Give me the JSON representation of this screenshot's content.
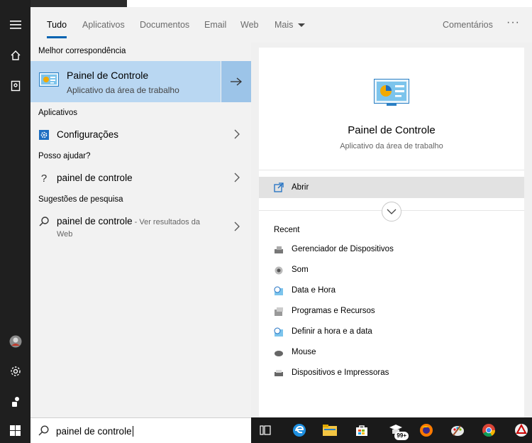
{
  "tabs": [
    {
      "label": "Tudo",
      "active": true
    },
    {
      "label": "Aplicativos"
    },
    {
      "label": "Documentos"
    },
    {
      "label": "Email"
    },
    {
      "label": "Web"
    },
    {
      "label": "Mais"
    }
  ],
  "feedback_label": "Comentários",
  "more_options": "···",
  "results": {
    "best_match_heading": "Melhor correspondência",
    "best_match": {
      "title": "Painel de Controle",
      "subtitle": "Aplicativo da área de trabalho"
    },
    "apps_heading": "Aplicativos",
    "apps": [
      {
        "label": "Configurações"
      }
    ],
    "help_heading": "Posso ajudar?",
    "help": [
      {
        "label": "painel de controle"
      }
    ],
    "suggestions_heading": "Sugestões de pesquisa",
    "suggestions": [
      {
        "label": "painel de controle",
        "suffix": " - Ver resultados da",
        "line2": "Web"
      }
    ]
  },
  "preview": {
    "title": "Painel de Controle",
    "subtitle": "Aplicativo da área de trabalho",
    "open_label": "Abrir",
    "recent_heading": "Recent",
    "recent": [
      {
        "label": "Gerenciador de Dispositivos",
        "icon": "device-manager-icon"
      },
      {
        "label": "Som",
        "icon": "speaker-icon"
      },
      {
        "label": "Data e Hora",
        "icon": "clock-icon"
      },
      {
        "label": "Programas e Recursos",
        "icon": "programs-icon"
      },
      {
        "label": "Definir a hora e a data",
        "icon": "clock-icon"
      },
      {
        "label": "Mouse",
        "icon": "mouse-icon"
      },
      {
        "label": "Dispositivos e Impressoras",
        "icon": "printer-icon"
      }
    ]
  },
  "search": {
    "value": "painel de controle"
  },
  "taskbar": {
    "store_badge": "99+"
  },
  "colors": {
    "accent": "#0063b1",
    "selected": "#b9d7f2",
    "rail": "#1f1f1f"
  }
}
